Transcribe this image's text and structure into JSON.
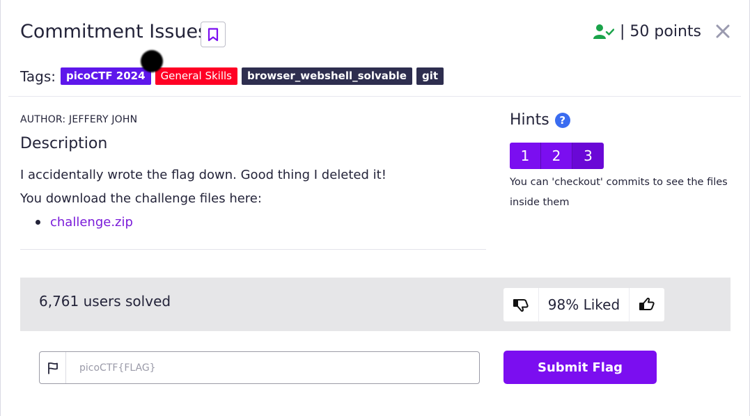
{
  "challenge": {
    "title": "Commitment Issues",
    "points_text": "| 50 points",
    "tags_label": "Tags:",
    "tags": [
      "picoCTF 2024",
      "General Skills",
      "browser_webshell_solvable",
      "git"
    ],
    "author": "AUTHOR: JEFFERY JOHN"
  },
  "description": {
    "heading": "Description",
    "line1": "I accidentally wrote the flag down. Good thing I deleted it!",
    "line2": "You download the challenge files here:",
    "link_text": "challenge.zip"
  },
  "hints": {
    "heading": "Hints",
    "help_glyph": "?",
    "tabs": [
      "1",
      "2",
      "3"
    ],
    "active_tab": "3",
    "text": "You can 'checkout' commits to see the files inside them"
  },
  "stats": {
    "solved_text": "6,761 users solved",
    "liked_text": "98% Liked"
  },
  "flag_form": {
    "placeholder": "picoCTF{FLAG}",
    "submit_label": "Submit Flag"
  },
  "icons": {
    "bookmark": "bookmark-icon",
    "solved_user": "user-check-icon",
    "close": "close-icon",
    "thumbs_down": "thumbs-down-icon",
    "thumbs_up": "thumbs-up-icon",
    "flag": "flag-icon"
  },
  "colors": {
    "accent": "#7b0ef0",
    "tag_purple": "#5e17eb",
    "tag_red": "#ff0024",
    "tag_dark": "#2e2e4f",
    "solved_green": "#1aa34a",
    "help_blue": "#3a6cf0"
  }
}
